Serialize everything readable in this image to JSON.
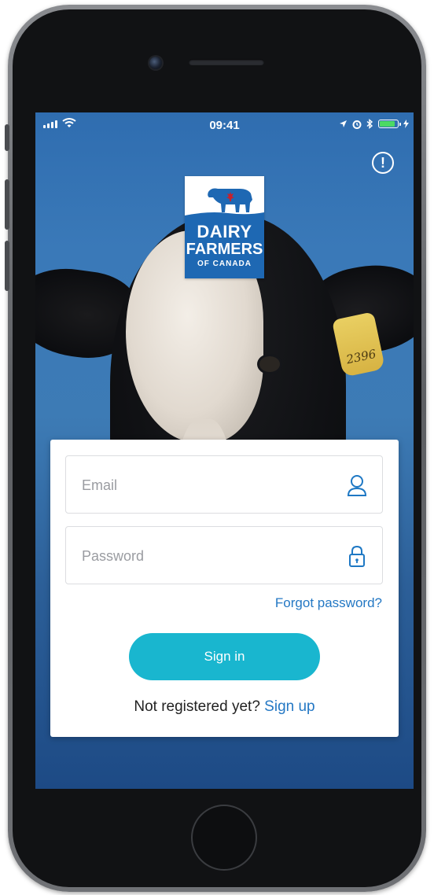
{
  "status_bar": {
    "time": "09:41",
    "battery_level": 0.8,
    "battery_color": "#4cd964"
  },
  "header": {
    "info_icon": "info-circle-icon",
    "info_symbol": "!"
  },
  "logo": {
    "line1": "DAIRY",
    "line2": "FARMERS",
    "line3": "OF CANADA",
    "brand_color": "#1e68b3"
  },
  "background": {
    "ear_tag_number": "2396"
  },
  "login": {
    "email_placeholder": "Email",
    "email_icon": "user-icon",
    "password_placeholder": "Password",
    "password_icon": "lock-icon",
    "forgot_password": "Forgot password?",
    "sign_in": "Sign in",
    "not_registered": "Not registered yet?",
    "sign_up": "Sign up",
    "accent_color": "#19b6cf",
    "link_color": "#2478c4"
  }
}
